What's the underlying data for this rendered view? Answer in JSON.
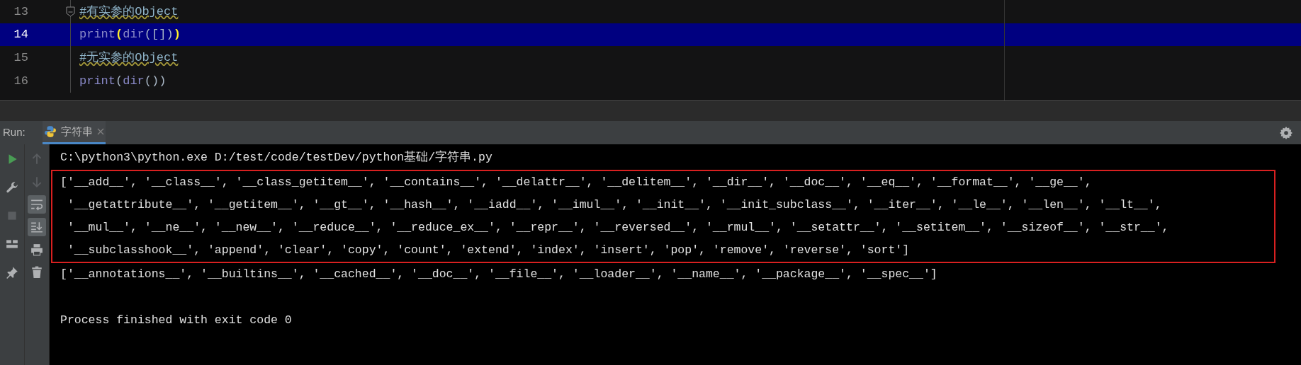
{
  "editor": {
    "lines": [
      {
        "number": "13",
        "current": false,
        "fold": true,
        "tokens": [
          {
            "kind": "comment",
            "text": "#有实参的Object"
          }
        ]
      },
      {
        "number": "14",
        "current": true,
        "fold": false,
        "tokens": [
          {
            "kind": "builtin",
            "text": "print"
          },
          {
            "kind": "brace_match",
            "text": "("
          },
          {
            "kind": "builtin",
            "text": "dir"
          },
          {
            "kind": "plain",
            "text": "([])"
          },
          {
            "kind": "brace_match",
            "text": ")"
          }
        ]
      },
      {
        "number": "15",
        "current": false,
        "fold": false,
        "tokens": [
          {
            "kind": "comment",
            "text": "#无实参的Object"
          }
        ]
      },
      {
        "number": "16",
        "current": false,
        "fold": false,
        "tokens": [
          {
            "kind": "builtin",
            "text": "print"
          },
          {
            "kind": "plain",
            "text": "("
          },
          {
            "kind": "builtin",
            "text": "dir"
          },
          {
            "kind": "plain",
            "text": "())"
          }
        ]
      }
    ]
  },
  "run_panel": {
    "label": "Run:",
    "tabs": [
      {
        "title": "字符串",
        "selected": true
      }
    ],
    "tools_left": [
      {
        "kind": "run",
        "disabled": false
      },
      {
        "kind": "wrench",
        "disabled": false
      },
      {
        "kind": "stop",
        "disabled": true
      },
      {
        "kind": "layout",
        "disabled": false
      },
      {
        "kind": "pin",
        "disabled": false
      }
    ],
    "tools_right": [
      {
        "kind": "up",
        "disabled": true,
        "active": false
      },
      {
        "kind": "down",
        "disabled": true,
        "active": false
      },
      {
        "kind": "wrap",
        "disabled": false,
        "active": true
      },
      {
        "kind": "scroll_end",
        "disabled": false,
        "active": true
      },
      {
        "kind": "print",
        "disabled": false,
        "active": false
      },
      {
        "kind": "trash",
        "disabled": false,
        "active": false
      }
    ],
    "output": {
      "command": "C:\\python3\\python.exe D:/test/code/testDev/python基础/字符串.py",
      "boxed_lines": [
        "['__add__', '__class__', '__class_getitem__', '__contains__', '__delattr__', '__delitem__', '__dir__', '__doc__', '__eq__', '__format__', '__ge__',",
        " '__getattribute__', '__getitem__', '__gt__', '__hash__', '__iadd__', '__imul__', '__init__', '__init_subclass__', '__iter__', '__le__', '__len__', '__lt__',",
        " '__mul__', '__ne__', '__new__', '__reduce__', '__reduce_ex__', '__repr__', '__reversed__', '__rmul__', '__setattr__', '__setitem__', '__sizeof__', '__str__',",
        " '__subclasshook__', 'append', 'clear', 'copy', 'count', 'extend', 'index', 'insert', 'pop', 'remove', 'reverse', 'sort']"
      ],
      "after_box": [
        "['__annotations__', '__builtins__', '__cached__', '__doc__', '__file__', '__loader__', '__name__', '__package__', '__spec__']"
      ],
      "exit_message": "Process finished with exit code 0"
    }
  }
}
